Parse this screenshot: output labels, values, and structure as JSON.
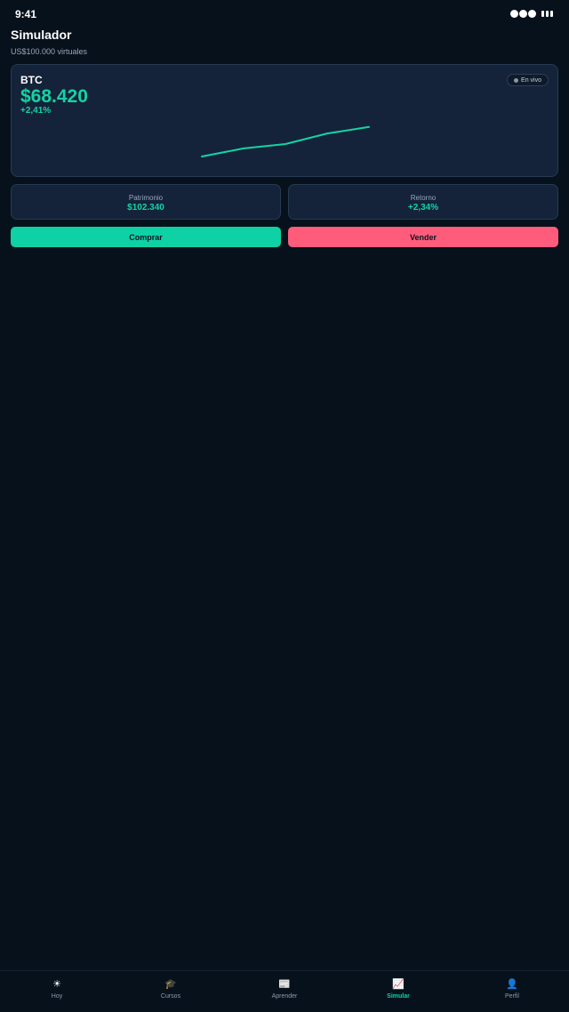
{
  "status": {
    "time": "9:41"
  },
  "header": {
    "title": "Simulador",
    "subtitle": "US$100.000 virtuales"
  },
  "price_card": {
    "ticker": "BTC",
    "price": "$68.420",
    "change": "+2,41%",
    "live_label": "En vivo",
    "sparkline": {
      "values": [
        0,
        0.26,
        0.4,
        0.74,
        0.95
      ],
      "color": "#14d3a5"
    }
  },
  "stats": [
    {
      "label": "Patrimonio",
      "value": "$102.340"
    },
    {
      "label": "Retorno",
      "value": "+2,34%"
    }
  ],
  "actions": {
    "buy_label": "Comprar",
    "sell_label": "Vender"
  },
  "tabs": [
    {
      "label": "Hoy",
      "icon": "sun-icon",
      "active": false
    },
    {
      "label": "Cursos",
      "icon": "graduation-cap-icon",
      "active": false
    },
    {
      "label": "Aprender",
      "icon": "newspaper-icon",
      "active": false
    },
    {
      "label": "Simular",
      "icon": "chart-increasing-icon",
      "active": true
    },
    {
      "label": "Perfil",
      "icon": "user-icon",
      "active": false
    }
  ],
  "colors": {
    "accent": "#14d3a5",
    "danger": "#ff5c7c",
    "background": "#06111c",
    "card": "#14233a"
  }
}
